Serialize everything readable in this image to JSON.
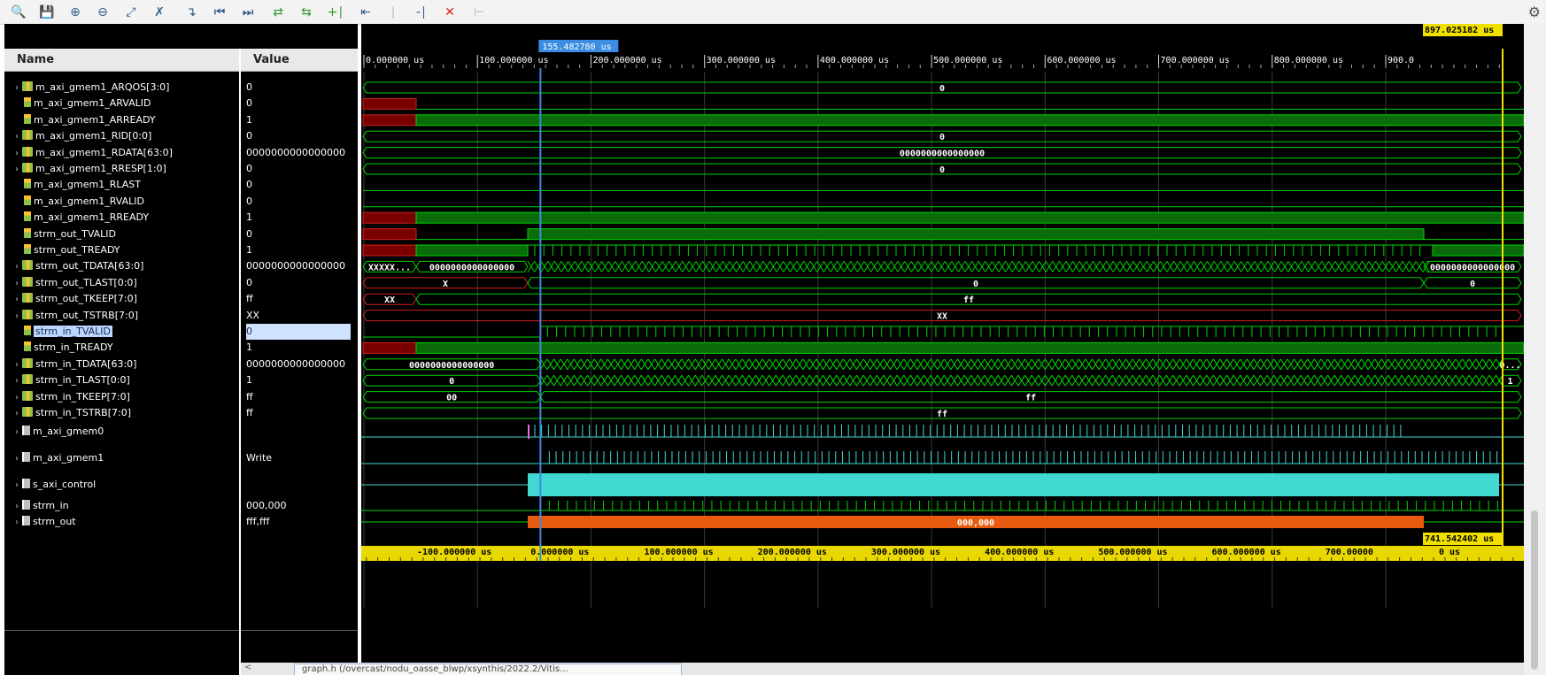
{
  "toolbar": {
    "icons": [
      "search-icon",
      "save-icon",
      "zoom-in-icon",
      "zoom-out-icon",
      "zoom-fit-icon",
      "cursor-icon",
      "go-to-icon",
      "first-icon",
      "last-icon",
      "add-marker-icon",
      "prev-edge-icon",
      "next-edge-icon",
      "swap-icon",
      "grey1-icon",
      "grey2-icon",
      "delete-icon",
      "grey3-icon"
    ],
    "settings_icon": "gear-icon"
  },
  "columns": {
    "name": "Name",
    "value": "Value"
  },
  "signals": [
    {
      "name": "m_axi_gmem1_ARQOS[3:0]",
      "value": "0",
      "kind": "bus"
    },
    {
      "name": "m_axi_gmem1_ARVALID",
      "value": "0",
      "kind": "bit"
    },
    {
      "name": "m_axi_gmem1_ARREADY",
      "value": "1",
      "kind": "bit"
    },
    {
      "name": "m_axi_gmem1_RID[0:0]",
      "value": "0",
      "kind": "bus"
    },
    {
      "name": "m_axi_gmem1_RDATA[63:0]",
      "value": "0000000000000000",
      "kind": "bus"
    },
    {
      "name": "m_axi_gmem1_RRESP[1:0]",
      "value": "0",
      "kind": "bus"
    },
    {
      "name": "m_axi_gmem1_RLAST",
      "value": "0",
      "kind": "bit"
    },
    {
      "name": "m_axi_gmem1_RVALID",
      "value": "0",
      "kind": "bit"
    },
    {
      "name": "m_axi_gmem1_RREADY",
      "value": "1",
      "kind": "bit"
    },
    {
      "name": "strm_out_TVALID",
      "value": "0",
      "kind": "bit"
    },
    {
      "name": "strm_out_TREADY",
      "value": "1",
      "kind": "bit"
    },
    {
      "name": "strm_out_TDATA[63:0]",
      "value": "0000000000000000",
      "kind": "bus"
    },
    {
      "name": "strm_out_TLAST[0:0]",
      "value": "0",
      "kind": "bus"
    },
    {
      "name": "strm_out_TKEEP[7:0]",
      "value": "ff",
      "kind": "bus"
    },
    {
      "name": "strm_out_TSTRB[7:0]",
      "value": "XX",
      "kind": "bus"
    },
    {
      "name": "strm_in_TVALID",
      "value": "0",
      "kind": "bit",
      "selected": true
    },
    {
      "name": "strm_in_TREADY",
      "value": "1",
      "kind": "bit"
    },
    {
      "name": "strm_in_TDATA[63:0]",
      "value": "0000000000000000",
      "kind": "bus"
    },
    {
      "name": "strm_in_TLAST[0:0]",
      "value": "1",
      "kind": "bus"
    },
    {
      "name": "strm_in_TKEEP[7:0]",
      "value": "ff",
      "kind": "bus"
    },
    {
      "name": "strm_in_TSTRB[7:0]",
      "value": "ff",
      "kind": "bus"
    }
  ],
  "groups": [
    {
      "name": "m_axi_gmem0",
      "value": ""
    },
    {
      "name": "m_axi_gmem1",
      "value": "Write"
    },
    {
      "name": "s_axi_control",
      "value": ""
    },
    {
      "name": "strm_in",
      "value": "000,000"
    },
    {
      "name": "strm_out",
      "value": "fff,fff"
    }
  ],
  "timeline": {
    "cursor_label": "155.482780 us",
    "end_label": "897.025182 us",
    "top_ticks": [
      "0.000000 us",
      "100.000000 us",
      "200.000000 us",
      "300.000000 us",
      "400.000000 us",
      "500.000000 us",
      "600.000000 us",
      "700.000000 us",
      "800.000000 us",
      "900.0"
    ],
    "marker_label": "741.542402 us",
    "bottom_ticks": [
      "-100.000000 us",
      "0.000000 us",
      "100.000000 us",
      "200.000000 us",
      "300.000000 us",
      "400.000000 us",
      "500.000000 us",
      "600.000000 us",
      "700.00000",
      "0 us"
    ]
  },
  "wave_labels": {
    "arqos": "0",
    "rid": "0",
    "rdata": "0000000000000000",
    "rresp": "0",
    "tdata_out_a": "XXXXX...",
    "tdata_out_b": "0000000000000000",
    "tdata_out_c": "0000000000000000",
    "tlast_out_a": "X",
    "tlast_out_b": "0",
    "tlast_out_c": "0",
    "tkeep_out_a": "XX",
    "tkeep_out_b": "ff",
    "tstrb_out": "XX",
    "tdata_in_a": "0000000000000000",
    "tdata_in_b": "0...",
    "tlast_in_a": "0",
    "tlast_in_b": "1",
    "tkeep_in_a": "00",
    "tkeep_in_b": "ff",
    "tstrb_in": "ff",
    "strm_out_group": "000,000"
  },
  "status_tab": "graph.h (/overcast/nodu_oasse_blwp/xsynthis/2022.2/Vitis..."
}
